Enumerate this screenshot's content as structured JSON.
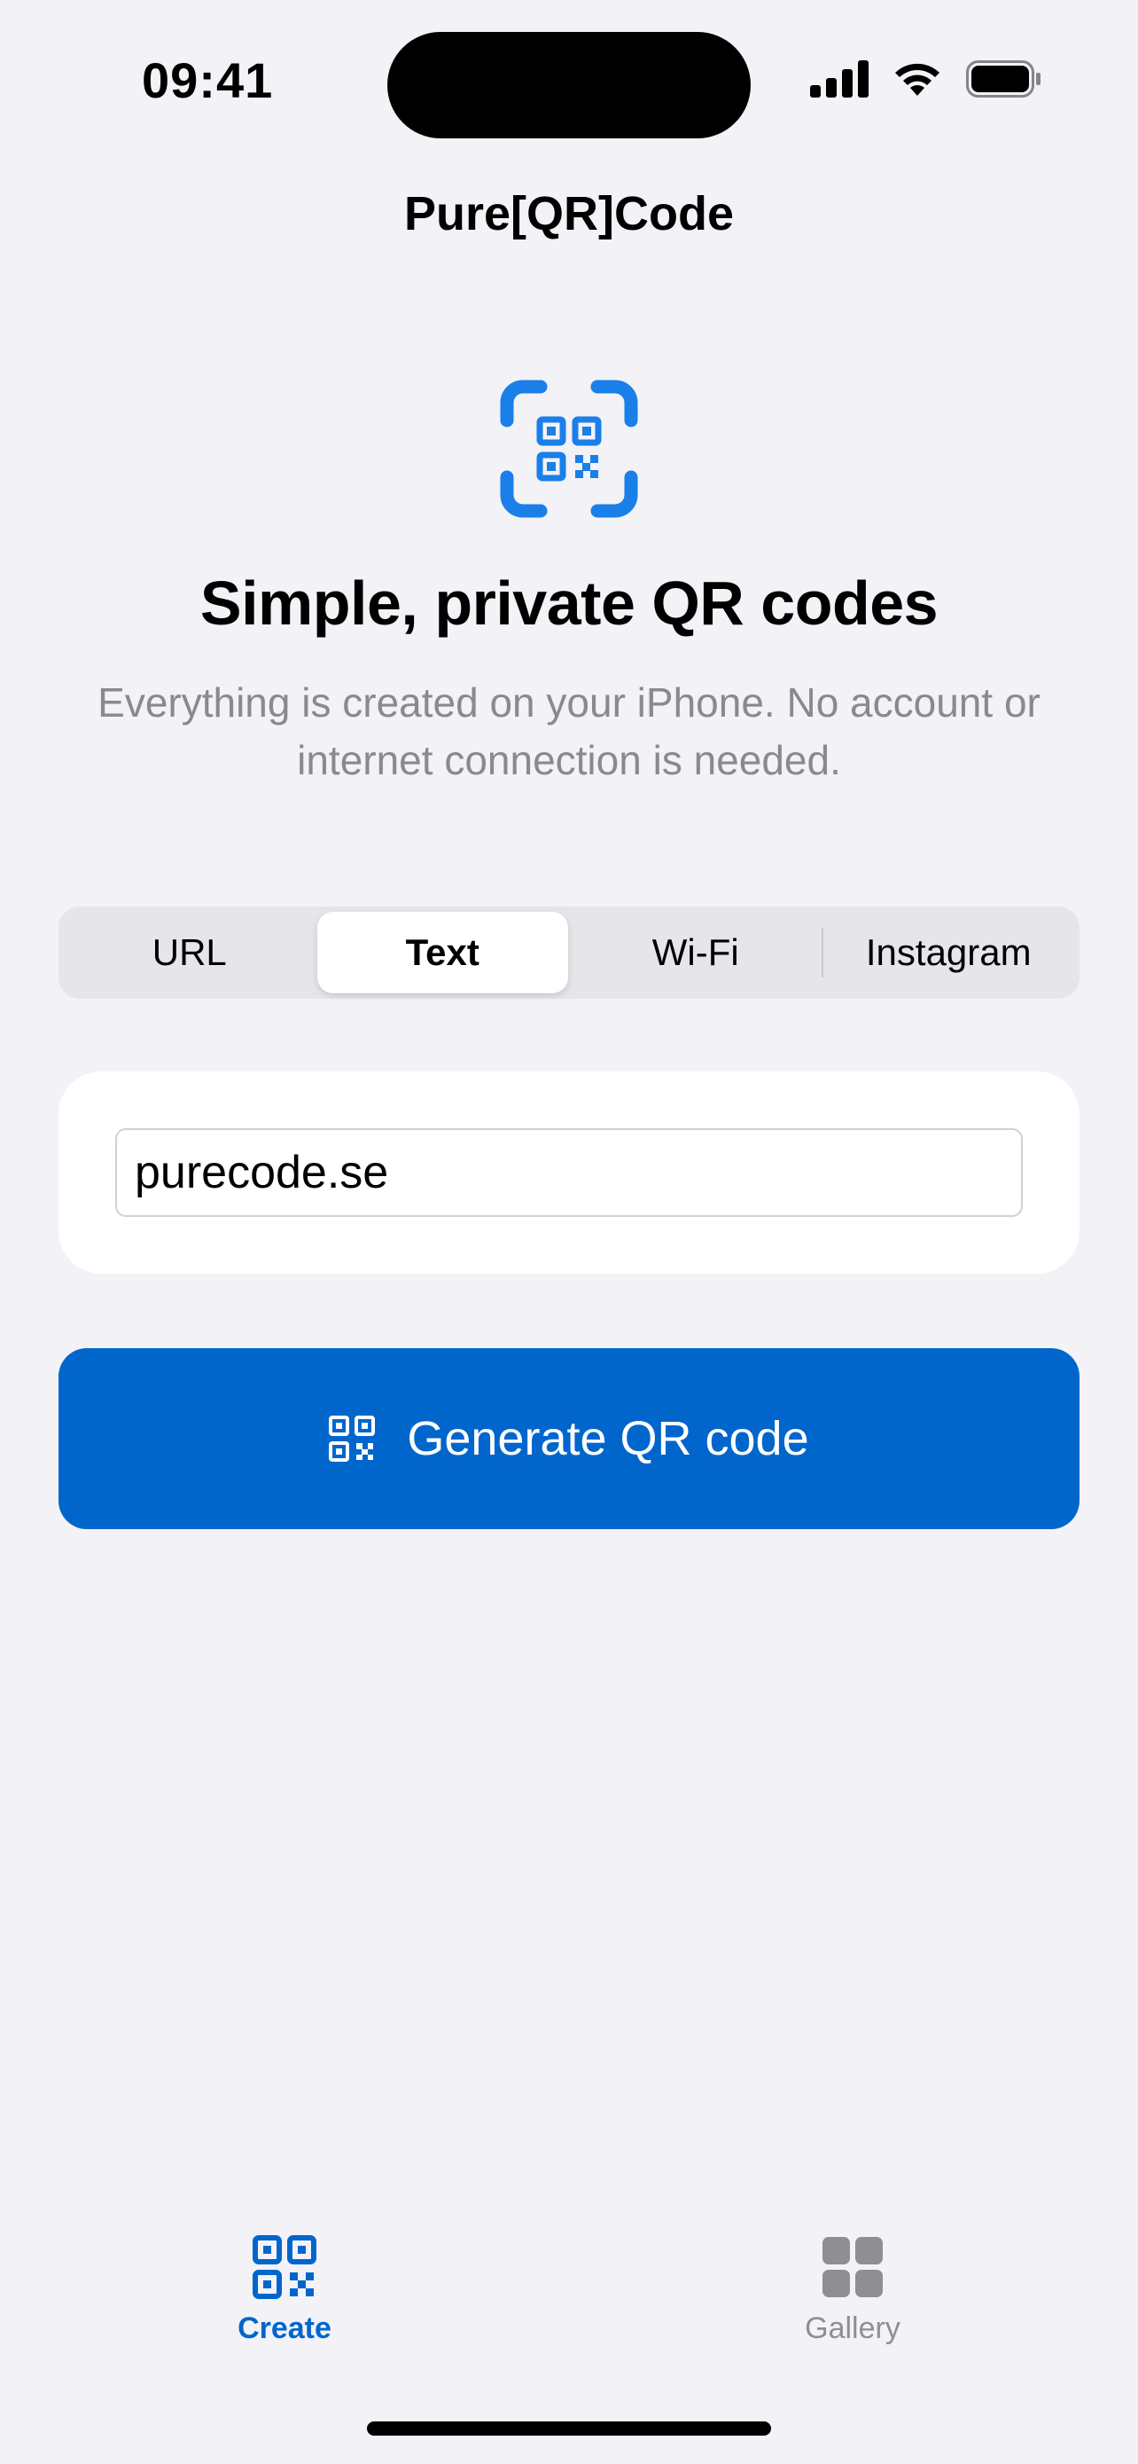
{
  "status_bar": {
    "time": "09:41",
    "icons": [
      "cellular-signal-icon",
      "wifi-icon",
      "battery-icon"
    ]
  },
  "nav": {
    "title": "Pure[QR]Code"
  },
  "hero": {
    "icon": "qr-scan-icon",
    "title": "Simple, private QR codes",
    "subtitle": "Everything is created on your iPhone. No account or internet connection is needed."
  },
  "segmented": {
    "options": [
      "URL",
      "Text",
      "Wi-Fi",
      "Instagram"
    ],
    "selected": "Text"
  },
  "input": {
    "value": "purecode.se"
  },
  "generate_button": {
    "icon": "qr-code-icon",
    "label": "Generate QR code"
  },
  "tab_bar": {
    "tabs": [
      {
        "label": "Create",
        "icon": "qr-code-icon",
        "selected": true
      },
      {
        "label": "Gallery",
        "icon": "grid-icon",
        "selected": false
      }
    ]
  },
  "colors": {
    "accent": "#0066cc",
    "hero_icon": "#1a7fe8",
    "background": "#f2f2f7",
    "secondary_text": "#8a8a8e",
    "inactive_tab": "#8e8e93"
  }
}
